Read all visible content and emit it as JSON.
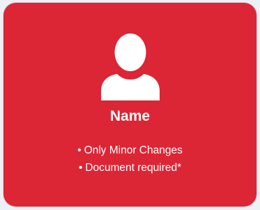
{
  "card": {
    "background_color": "#dc2535",
    "avatar_icon": "user-avatar-icon",
    "title": "Name",
    "features": [
      {
        "bullet": "•",
        "text": "Only Minor Changes"
      },
      {
        "bullet": "•",
        "text": "Document required*"
      }
    ]
  }
}
